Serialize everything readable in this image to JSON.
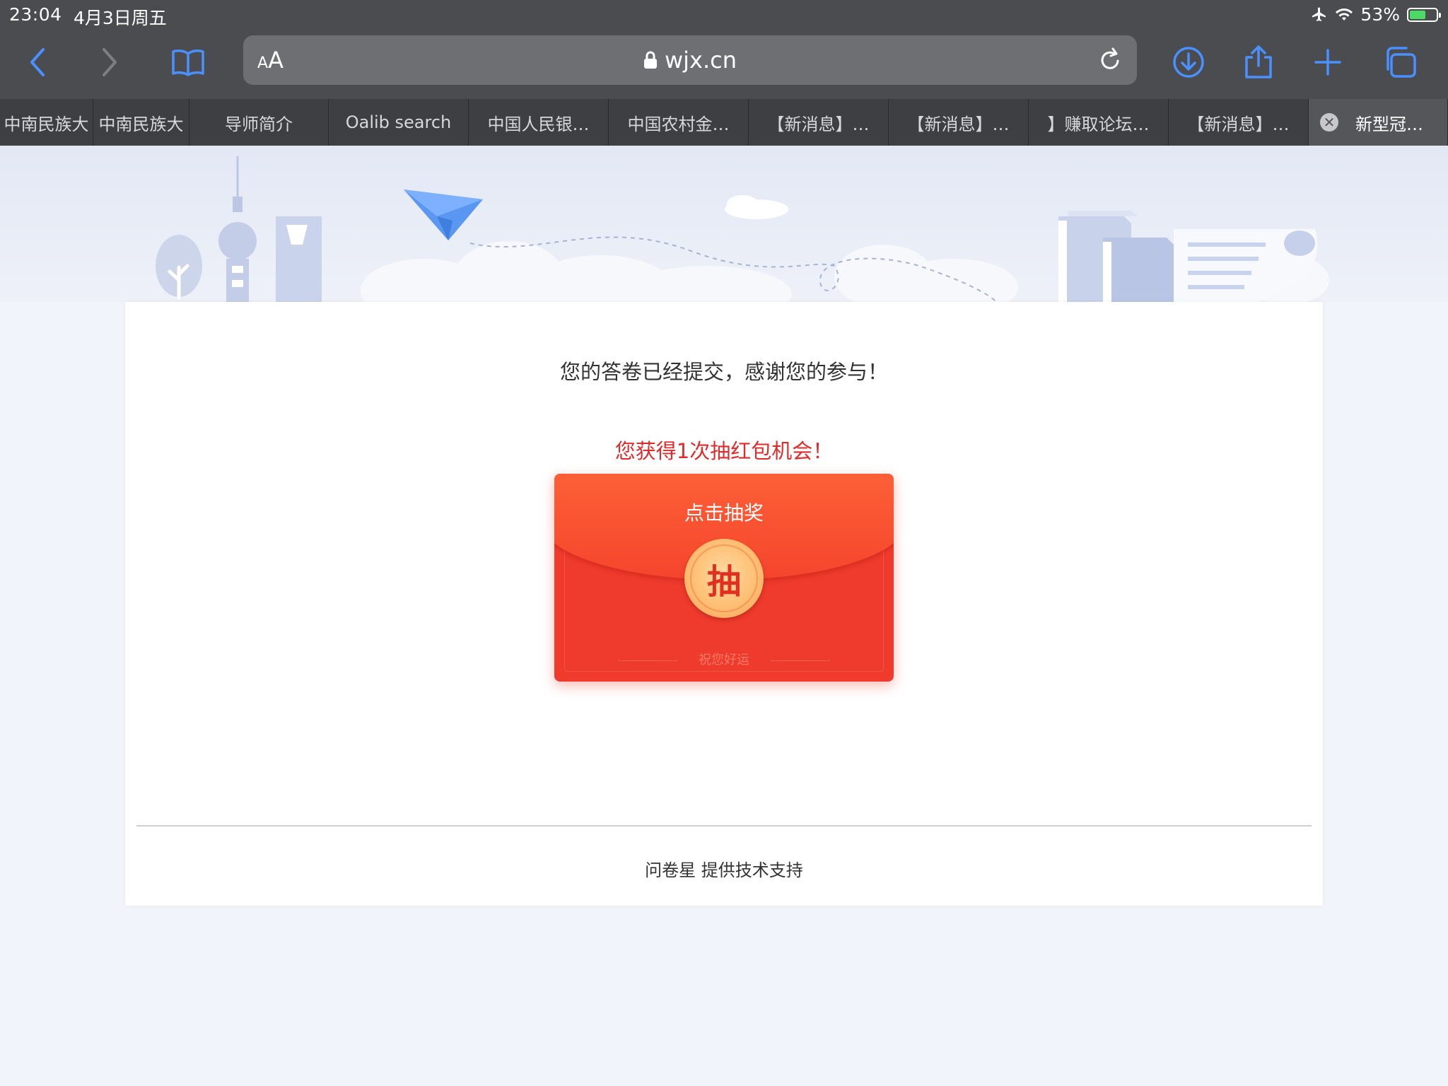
{
  "status": {
    "time": "23:04",
    "date": "4月3日周五",
    "battery": "53%"
  },
  "toolbar": {
    "text_size_label": "AA",
    "url": "wjx.cn"
  },
  "tabs": [
    {
      "label": "中南民族大"
    },
    {
      "label": "中南民族大"
    },
    {
      "label": "导师简介"
    },
    {
      "label": "Oalib search"
    },
    {
      "label": "中国人民银…"
    },
    {
      "label": "中国农村金…"
    },
    {
      "label": "【新消息】…"
    },
    {
      "label": "【新消息】…"
    },
    {
      "label": "】赚取论坛…"
    },
    {
      "label": "【新消息】…"
    },
    {
      "label": "新型冠…",
      "close": "✕"
    }
  ],
  "page": {
    "thanks": "您的答卷已经提交，感谢您的参与！",
    "prize": "您获得1次抽红包机会！",
    "envelope_title": "点击抽奖",
    "coin_label": "抽",
    "luck_text": "祝您好运",
    "footer": "问卷星 提供技术支持"
  },
  "colors": {
    "accent": "#4a90ff",
    "red": "#ee3b2e",
    "prize_text": "#e02b2b"
  },
  "icons": [
    "back-icon",
    "forward-icon",
    "bookmarks-icon",
    "lock-icon",
    "reload-icon",
    "download-icon",
    "share-icon",
    "new-tab-icon",
    "tabs-overview-icon",
    "airplane-mode-icon",
    "wifi-icon",
    "battery-icon"
  ]
}
